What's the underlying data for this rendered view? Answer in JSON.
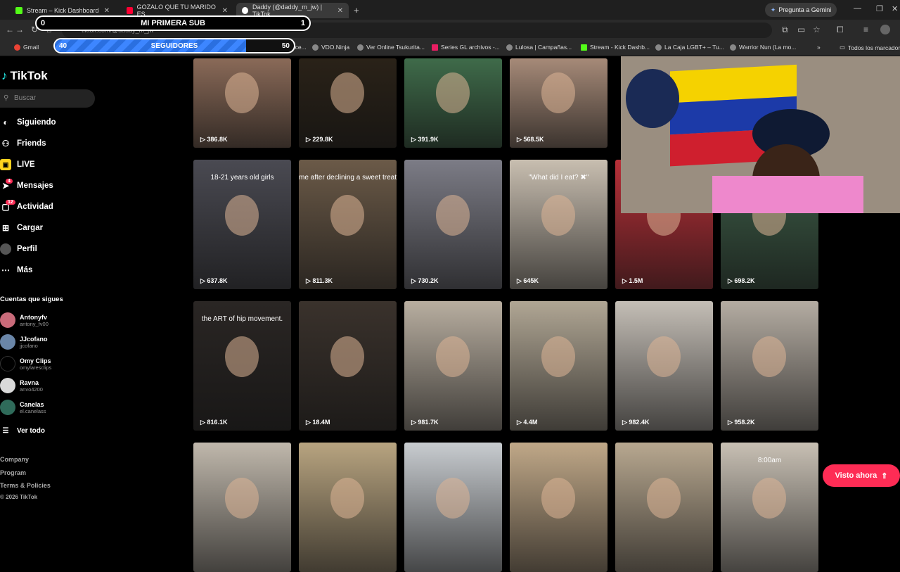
{
  "browser": {
    "tabs": [
      {
        "label": "Stream – Kick Dashboard",
        "color": "#53fc18"
      },
      {
        "label": "GOZALO QUE TU MARIDO ES...",
        "color": "#ff0033"
      },
      {
        "label": "Daddy (@daddy_m_jw) | TikTok",
        "color": "#ffffff"
      }
    ],
    "new_tab": "+",
    "gemini_label": "Pregunta a Gemini",
    "url": "tiktok.com/@daddy_m_jw",
    "bookmarks": [
      "Gmail",
      "Pro Evolution Socce...",
      "VDO.Ninja",
      "Ver Online Tsukurita...",
      "Series GL archivos -...",
      "Lulosa | Campañas...",
      "Stream - Kick Dashb...",
      "La Caja LGBT+ – Tu...",
      "Warrior Nun (La mo..."
    ],
    "bookmarks_more": "»",
    "all_bookmarks": "Todos los marcadores"
  },
  "overlay": {
    "sub_title": "MI PRIMERA SUB",
    "sub_left": "0",
    "sub_right": "1",
    "followers_label": "SEGUIDORES",
    "followers_current": "40",
    "followers_goal": "50",
    "followers_fraction": 0.8
  },
  "sidebar": {
    "logo": "TikTok",
    "search_placeholder": "Buscar",
    "nav": [
      {
        "label": "Siguiendo",
        "icon": "following-icon"
      },
      {
        "label": "Friends",
        "icon": "friends-icon"
      },
      {
        "label": "LIVE",
        "icon": "live-icon"
      },
      {
        "label": "Mensajes",
        "icon": "messages-icon",
        "badge": "4"
      },
      {
        "label": "Actividad",
        "icon": "activity-icon",
        "badge": "12"
      },
      {
        "label": "Cargar",
        "icon": "upload-icon"
      },
      {
        "label": "Perfil",
        "icon": "profile-icon"
      },
      {
        "label": "Más",
        "icon": "more-icon"
      }
    ],
    "following_title": "Cuentas que sigues",
    "accounts": [
      {
        "name": "Antonyfv",
        "handle": "antony_fv00",
        "color": "#c96b7a"
      },
      {
        "name": "JJcofano",
        "handle": "jjcofano",
        "color": "#6a86a8"
      },
      {
        "name": "Omy Clips",
        "handle": "omylaresclips",
        "color": "#000000"
      },
      {
        "name": "Ravna",
        "handle": "anvo4200",
        "color": "#d9d9d9"
      },
      {
        "name": "Canelas",
        "handle": "el.canelass",
        "color": "#2f6b5a"
      }
    ],
    "see_all": "Ver todo",
    "footer": [
      "Company",
      "Program",
      "Terms & Policies",
      "© 2026 TikTok"
    ]
  },
  "videos": [
    {
      "views": "386.8K",
      "bg": "#8a6a58"
    },
    {
      "views": "229.8K",
      "bg": "#2a2218"
    },
    {
      "views": "391.9K",
      "bg": "#3f6b4a"
    },
    {
      "views": "568.5K",
      "bg": "#a68a78"
    },
    {
      "views": "637.8K",
      "bg": "#4a4a52",
      "caption": "18-21 years old girls"
    },
    {
      "views": "811.3K",
      "bg": "#6b5a48",
      "caption": "me after declining a sweet treat"
    },
    {
      "views": "730.2K",
      "bg": "#7c7c86"
    },
    {
      "views": "645K",
      "bg": "#c8beb0",
      "caption": "\"What did I eat? ✖\""
    },
    {
      "views": "1.5M",
      "bg": "#b83038"
    },
    {
      "views": "698.2K",
      "bg": "#3e5e48"
    },
    {
      "views": "816.1K",
      "bg": "#2a2624",
      "caption": "the ART of hip movement."
    },
    {
      "views": "18.4M",
      "bg": "#3a322c"
    },
    {
      "views": "981.7K",
      "bg": "#b8aea0"
    },
    {
      "views": "4.4M",
      "bg": "#b0a694"
    },
    {
      "views": "982.4K",
      "bg": "#c4beb6"
    },
    {
      "views": "958.2K",
      "bg": "#b4aca2"
    },
    {
      "views": "",
      "bg": "#c0b8ac"
    },
    {
      "views": "",
      "bg": "#b8a480"
    },
    {
      "views": "",
      "bg": "#c8ccd0"
    },
    {
      "views": "",
      "bg": "#c0a888"
    },
    {
      "views": "",
      "bg": "#b8a890"
    },
    {
      "views": "",
      "bg": "#c8c0b4",
      "caption": "8:00am"
    }
  ],
  "visto_ahora": "Visto ahora"
}
